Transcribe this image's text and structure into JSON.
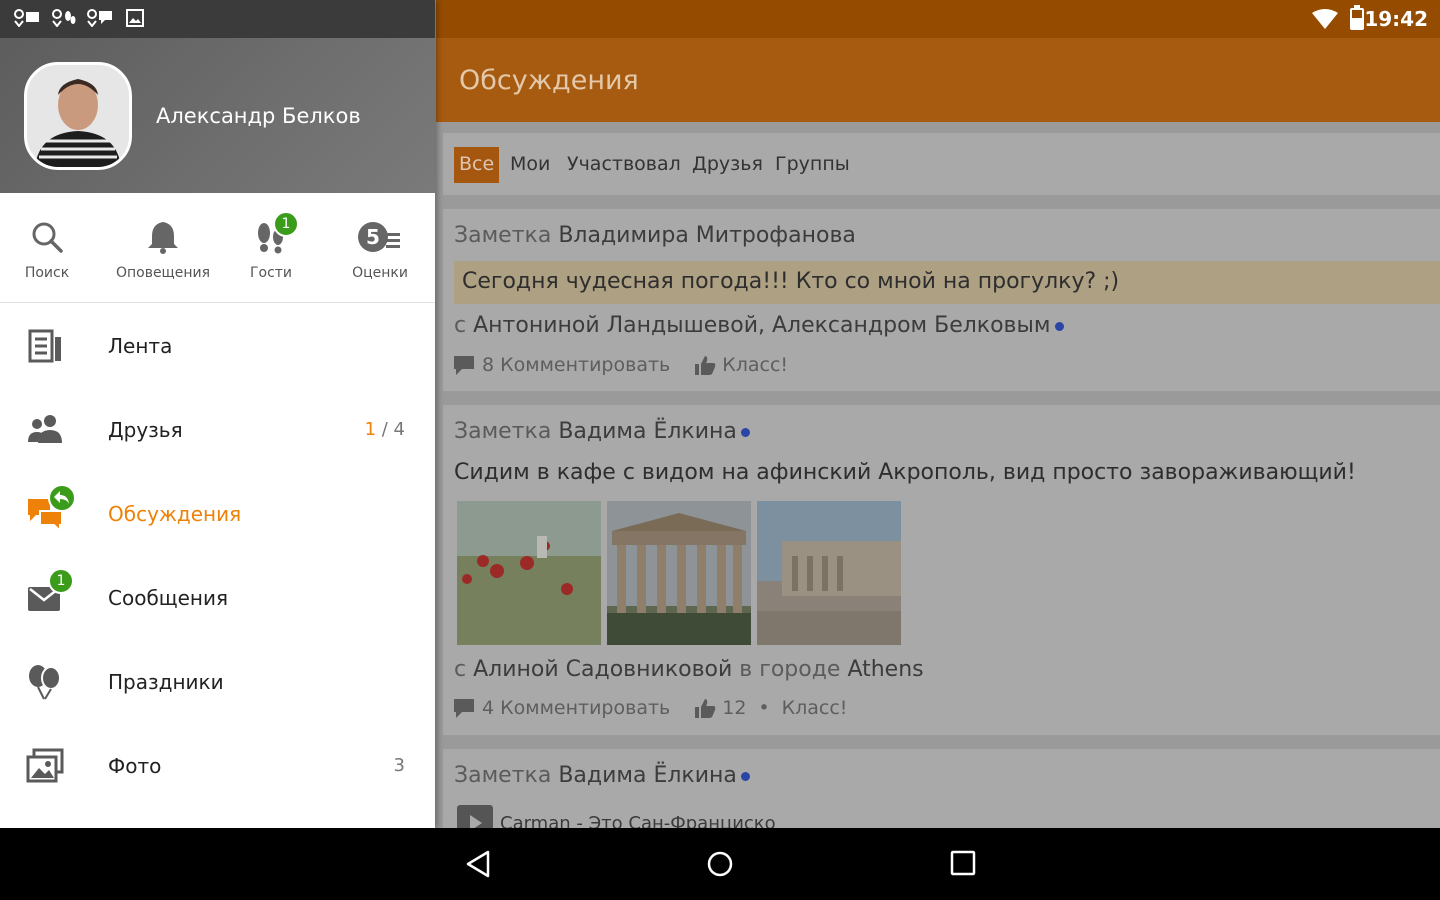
{
  "status": {
    "time": "19:42",
    "left_icons": [
      "ok-mail-icon",
      "ok-guests-icon",
      "ok-messages-icon",
      "image-icon"
    ]
  },
  "colors": {
    "accent": "#ee8208",
    "appbar": "#a65b10",
    "badge": "#3b9c1b",
    "unread_dot": "#2b45a7"
  },
  "drawer": {
    "profile_name": "Александр Белков",
    "quick": [
      {
        "label": "Поиск",
        "icon": "search-icon"
      },
      {
        "label": "Оповещения",
        "icon": "bell-icon"
      },
      {
        "label": "Гости",
        "icon": "footprints-icon",
        "badge": "1"
      },
      {
        "label": "Оценки",
        "icon": "ratings-icon",
        "badge_text": "5"
      }
    ],
    "nav": [
      {
        "label": "Лента",
        "icon": "feed-icon"
      },
      {
        "label": "Друзья",
        "icon": "friends-icon",
        "count_new": "1",
        "count_sep": " / ",
        "count_total": "4"
      },
      {
        "label": "Обсуждения",
        "icon": "discussions-icon",
        "active": true
      },
      {
        "label": "Сообщения",
        "icon": "messages-icon",
        "badge": "1"
      },
      {
        "label": "Праздники",
        "icon": "balloons-icon"
      },
      {
        "label": "Фото",
        "icon": "photo-icon",
        "count": "3"
      }
    ]
  },
  "appbar": {
    "title": "Обсуждения"
  },
  "filters": {
    "tabs": [
      "Все",
      "Мои",
      "Участвовал",
      "Друзья",
      "Группы"
    ],
    "active": "Все"
  },
  "posts": [
    {
      "prefix": "Заметка",
      "author": "Владимира Митрофанова",
      "text": "Сегодня чудесная погода!!! Кто со мной на прогулку? ;)",
      "with_prefix": "с",
      "with": "Антониной Ландышевой, Александром Белковым",
      "comments": "8 Комментировать",
      "like": "Класс!"
    },
    {
      "prefix": "Заметка",
      "author": "Вадима Ёлкина",
      "text": "Сидим в кафе с видом на афинский Акрополь, вид просто завораживающий!",
      "with_prefix": "с",
      "with": "Алиной Садовниковой",
      "city_prefix": "в городе",
      "city": "Athens",
      "comments": "4 Комментировать",
      "likes": "12",
      "bullet": "•",
      "like": "Класс!"
    },
    {
      "prefix": "Заметка",
      "author": "Вадима Ёлкина",
      "audio": "Carman - Это Сан-Франциско"
    }
  ]
}
